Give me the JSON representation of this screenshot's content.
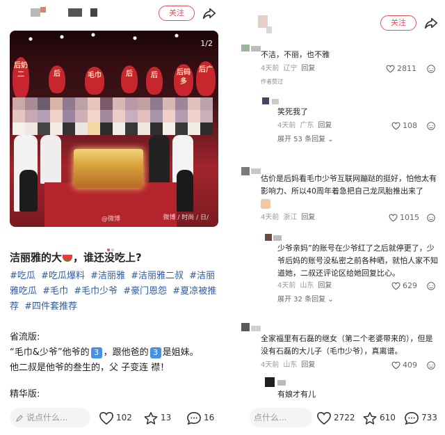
{
  "left": {
    "header": {
      "follow_label": "关注"
    },
    "image": {
      "counter": "1/2",
      "watermark": "微博 / 时尚 / 日/",
      "weibo_tag": "@微博",
      "signs": [
        "后奶二",
        "后",
        "毛巾",
        "后",
        "后",
        "后码多",
        "后广"
      ]
    },
    "title": "洁丽雅的大",
    "title_suffix": "，谁还没吃上?",
    "tags": [
      "#吃瓜",
      "#吃瓜爆料",
      "#洁丽雅",
      "#洁丽雅二叔",
      "#洁丽雅吃瓜",
      "#毛巾",
      "#毛巾少爷",
      "#豪门恩怨",
      "#夏凉被推荐",
      "#四件套推荐"
    ],
    "section1_heading": "省流版:",
    "line1_a": "“毛巾&少爷”他爷的",
    "line1_badge1": "3",
    "line1_b": "，跟他爸的",
    "line1_badge2": "3",
    "line1_c": "是姐妹。",
    "line2": "他二叔是他爷的叁生的，父 子变连 襟！",
    "section2_heading": "精华版:",
    "bottom": {
      "comment_placeholder": "说点什么...",
      "likes": "102",
      "favorites": "13",
      "comments": "16"
    }
  },
  "right": {
    "header": {
      "follow_label": "关注"
    },
    "comments": [
      {
        "text": "不洁，不丽，也不雅",
        "time": "4天前",
        "location": "辽宁",
        "reply": "回复",
        "likes": "2811"
      },
      {
        "author_tag": "作者赞过",
        "text": "笑死我了",
        "time": "4天前",
        "location": "广东",
        "reply": "回复",
        "likes": "108",
        "expand": "展开 53 条回复"
      },
      {
        "text": "估价是后妈看毛巾少爷互联网蹦跶的挺好，怕他太有影响力、所以40周年着急把自己龙凤胎推出来了",
        "time": "4天前",
        "location": "浙江",
        "reply": "回复",
        "likes": "1015"
      },
      {
        "text": "少爷亲妈”的账号在少爷红了之后就停更了，少爷后妈的账号没私密之前各种晒，就怕人家不知道她，二叔还评论区给她回复比心。",
        "time": "4天前",
        "location": "山东",
        "reply": "回复",
        "likes": "629",
        "expand": "展开 32 条回复"
      },
      {
        "text": "全家福里有石磊的继女（第二个老婆带来的），但是没有石磊的大儿子（毛巾少爷），真离谱。",
        "time": "4天前",
        "location": "山东",
        "reply": "回复",
        "likes": "409"
      },
      {
        "text": "有娘才有儿"
      }
    ],
    "bottom": {
      "comment_placeholder": "点什么...",
      "likes": "2722",
      "favorites": "610",
      "comments": "733"
    }
  },
  "colors": {
    "accent": "#e04e5d",
    "tag": "#2d5ba6",
    "meta": "#999999"
  }
}
